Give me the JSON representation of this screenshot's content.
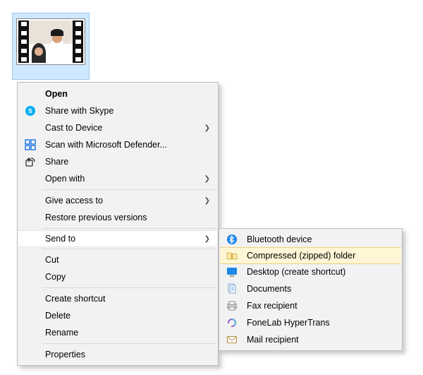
{
  "file": {
    "selected": true
  },
  "context_menu": {
    "open": "Open",
    "skype": "Share with Skype",
    "cast": "Cast to Device",
    "defender": "Scan with Microsoft Defender...",
    "share": "Share",
    "open_with": "Open with",
    "give_access": "Give access to",
    "restore": "Restore previous versions",
    "send_to": "Send to",
    "cut": "Cut",
    "copy": "Copy",
    "shortcut": "Create shortcut",
    "delete": "Delete",
    "rename": "Rename",
    "properties": "Properties"
  },
  "send_to_submenu": {
    "bluetooth": "Bluetooth device",
    "compressed": "Compressed (zipped) folder",
    "desktop": "Desktop (create shortcut)",
    "documents": "Documents",
    "fax": "Fax recipient",
    "fonelab": "FoneLab HyperTrans",
    "mail": "Mail recipient"
  }
}
